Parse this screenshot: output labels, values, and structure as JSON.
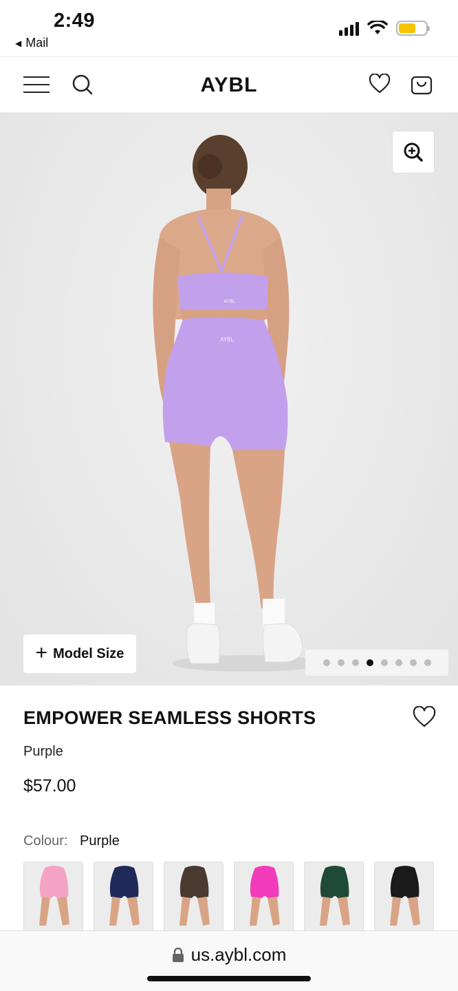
{
  "status_bar": {
    "time": "2:49",
    "back_label": "Mail"
  },
  "header": {
    "logo": "AYBL"
  },
  "hero": {
    "model_size_label": "Model Size",
    "carousel": {
      "total": 8,
      "active_index": 3
    },
    "print_top": "AYBL",
    "print_waist": "AYBL"
  },
  "product": {
    "title": "EMPOWER SEAMLESS SHORTS",
    "color": "Purple",
    "price": "$57.00",
    "colour_label": "Colour:",
    "colour_value": "Purple"
  },
  "swatches": [
    {
      "name": "Pink",
      "color": "#f4a3c4"
    },
    {
      "name": "Navy",
      "color": "#1f2a5a"
    },
    {
      "name": "Brown",
      "color": "#4a3a30"
    },
    {
      "name": "Magenta",
      "color": "#f13bbb"
    },
    {
      "name": "Green",
      "color": "#1f4a38"
    },
    {
      "name": "Black",
      "color": "#1a1a1a"
    }
  ],
  "colors": {
    "accent_product": "#c3a0ec",
    "battery": "#f6c400"
  },
  "browser": {
    "url": "us.aybl.com"
  }
}
